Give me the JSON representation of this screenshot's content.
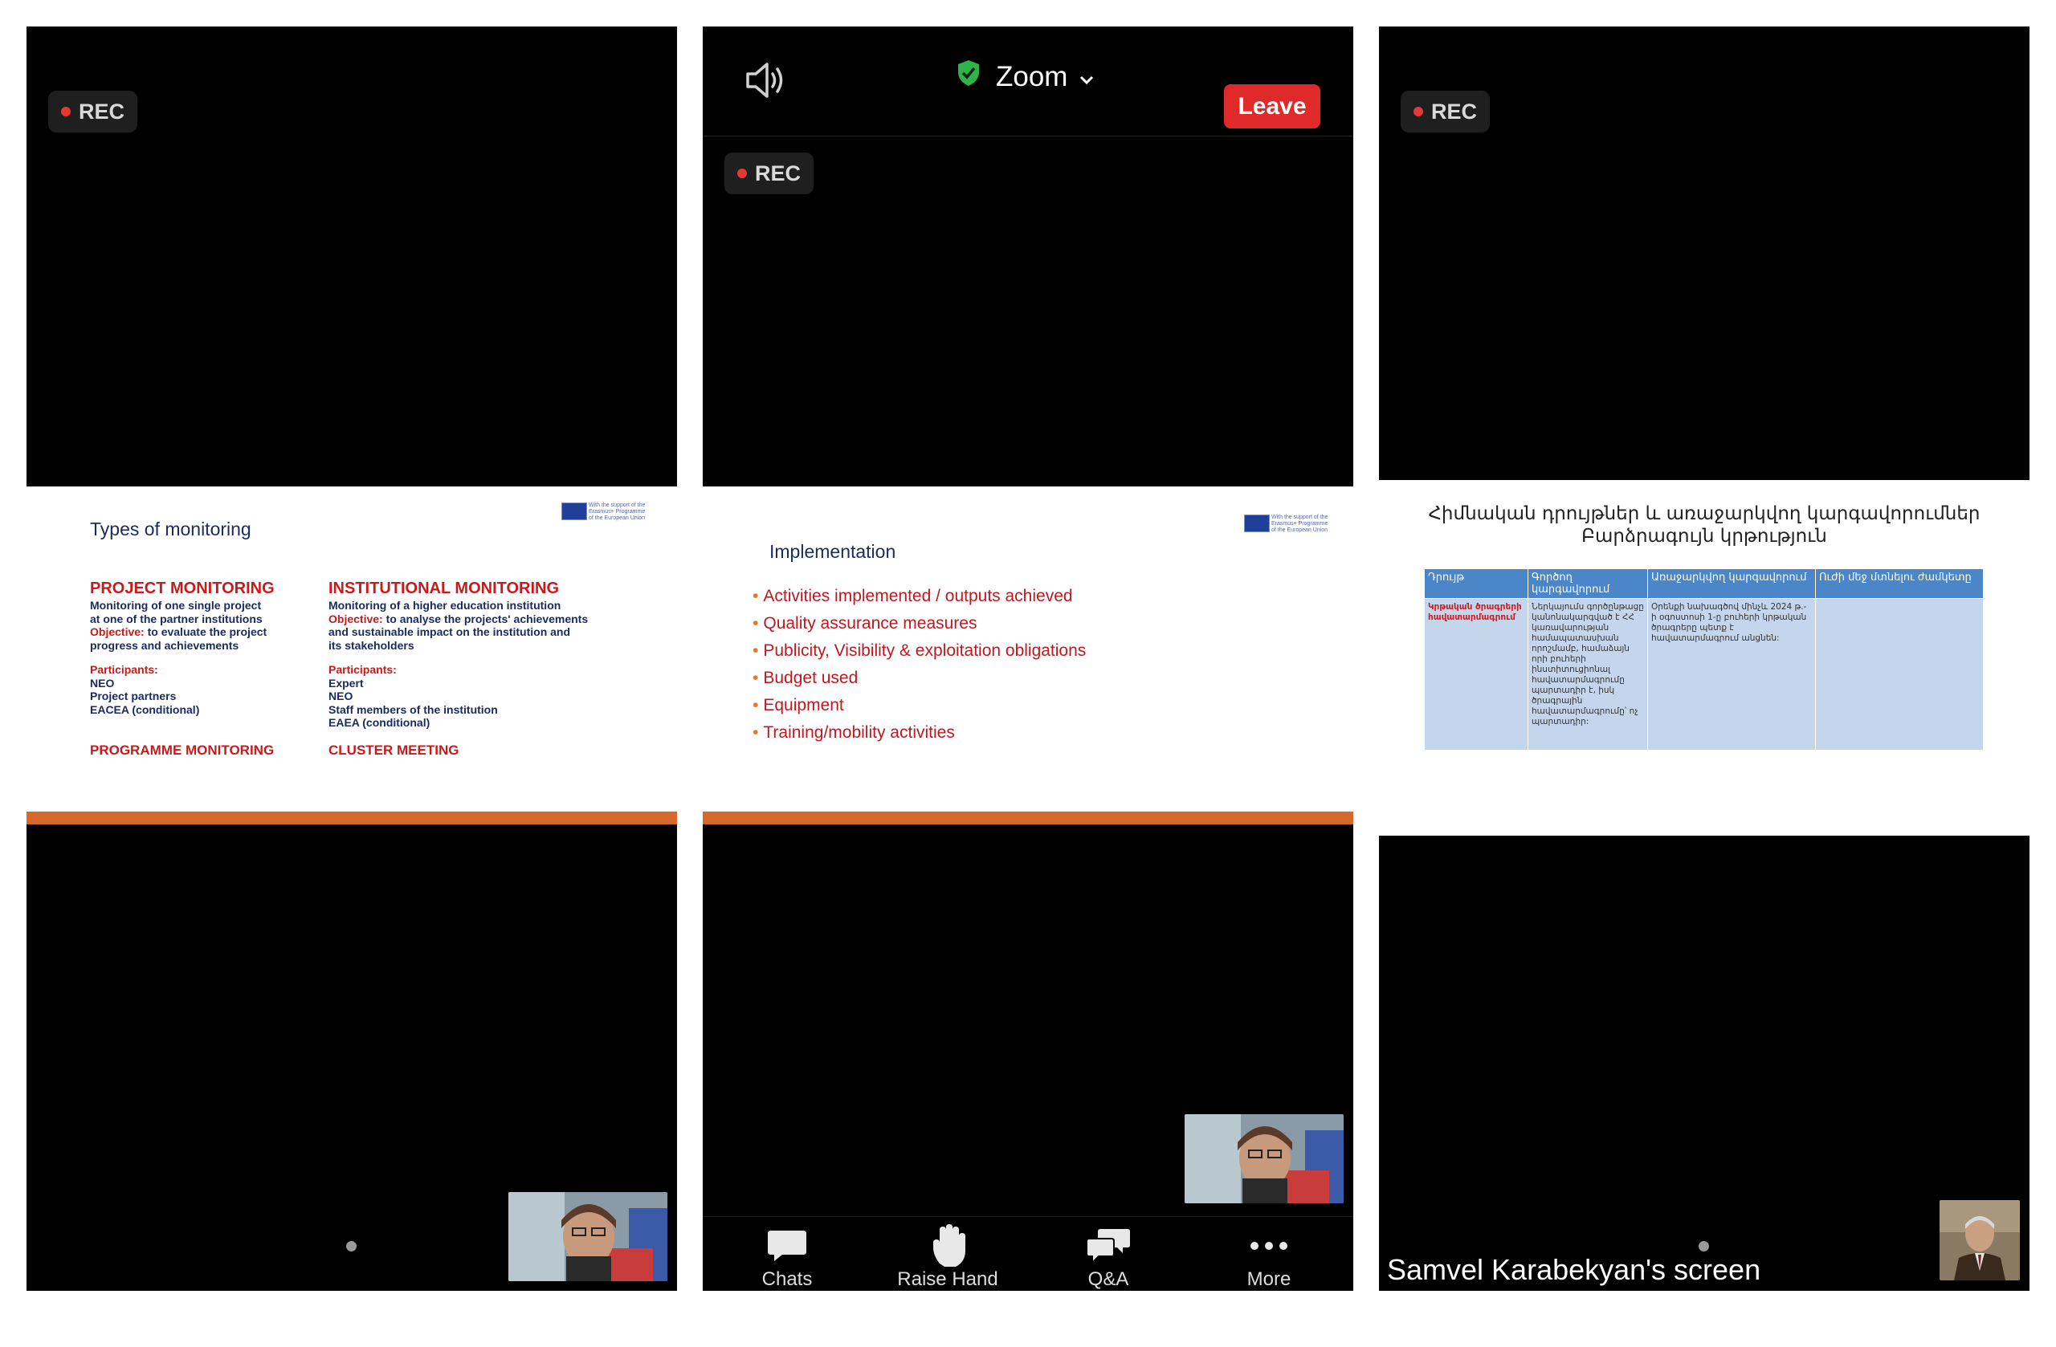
{
  "panels": [
    {
      "rec_label": "REC",
      "slide": {
        "title": "Types of monitoring",
        "project": {
          "heading": "PROJECT MONITORING",
          "desc1": "Monitoring of one single project",
          "desc2": "at one of the partner institutions",
          "objective_label": "Objective:",
          "objective_text": " to evaluate the project",
          "objective_text2": "progress and achievements",
          "participants_label": "Participants:",
          "participants": [
            "NEO",
            "Project partners",
            "EACEA (conditional)"
          ]
        },
        "institutional": {
          "heading": "INSTITUTIONAL MONITORING",
          "desc1": "Monitoring of a higher education institution",
          "objective_label": "Objective:",
          "objective_text": " to analyse the projects' achievements",
          "objective_text2": "and sustainable impact on the institution and",
          "objective_text3": "its stakeholders",
          "participants_label": "Participants:",
          "participants": [
            "Expert",
            "NEO",
            "Staff members of the institution",
            "EAEA (conditional)"
          ]
        },
        "programme": "PROGRAMME MONITORING",
        "cluster": "CLUSTER MEETING",
        "eu_text": "With the support of the Erasmus+ Programme of the European Union"
      }
    },
    {
      "rec_label": "REC",
      "topbar": {
        "app_name": "Zoom",
        "leave_label": "Leave"
      },
      "slide": {
        "title": "Implementation",
        "bullets": [
          "Activities implemented / outputs achieved",
          "Quality assurance measures",
          "Publicity, Visibility & exploitation obligations",
          "Budget used",
          "Equipment",
          "Training/mobility activities"
        ],
        "eu_text": "With the support of the Erasmus+ Programme of the European Union"
      },
      "toolbar": {
        "chats": "Chats",
        "raise_hand": "Raise Hand",
        "qa": "Q&A",
        "more": "More"
      }
    },
    {
      "rec_label": "REC",
      "slide": {
        "title_line1": "Հիմնական դրույթներ և առաջարկվող կարգավորումներ",
        "title_line2": "Բարձրագույն կրթություն",
        "headers": [
          "Դրույթ",
          "Գործող կարգավորում",
          "Առաջարկվող կարգավորում",
          "Ուժի մեջ մտնելու ժամկետը"
        ],
        "row": [
          "Կրթական ծրագրերի հավատարմագրում",
          "Ներկայումս գործընթացը կանոնակարգված է ՀՀ կառավարության համապատասխան որոշմամբ, համաձայն որի բուհերի ինստիտուցիոնալ հավատարմագրումը պարտադիր է, իսկ ծրագրային հավատարմագրումը՝ ոչ պարտադիր:",
          "Օրենքի նախագծով մինչև 2024 թ.-ի օգոստոսի 1-ը բուհերի կրթական ծրագրերը պետք է հավատարմագրում անցնեն:",
          ""
        ]
      },
      "screen_name": "Samvel Karabekyan's screen"
    }
  ],
  "colors": {
    "rec_dot": "#e53935",
    "leave_bg": "#e02a2a",
    "slide_red": "#c81a1a",
    "slide_navy": "#1b2a5f",
    "orange_bar": "#d4692b",
    "table_header": "#4a86c8",
    "table_cell": "#c5d6ec"
  }
}
